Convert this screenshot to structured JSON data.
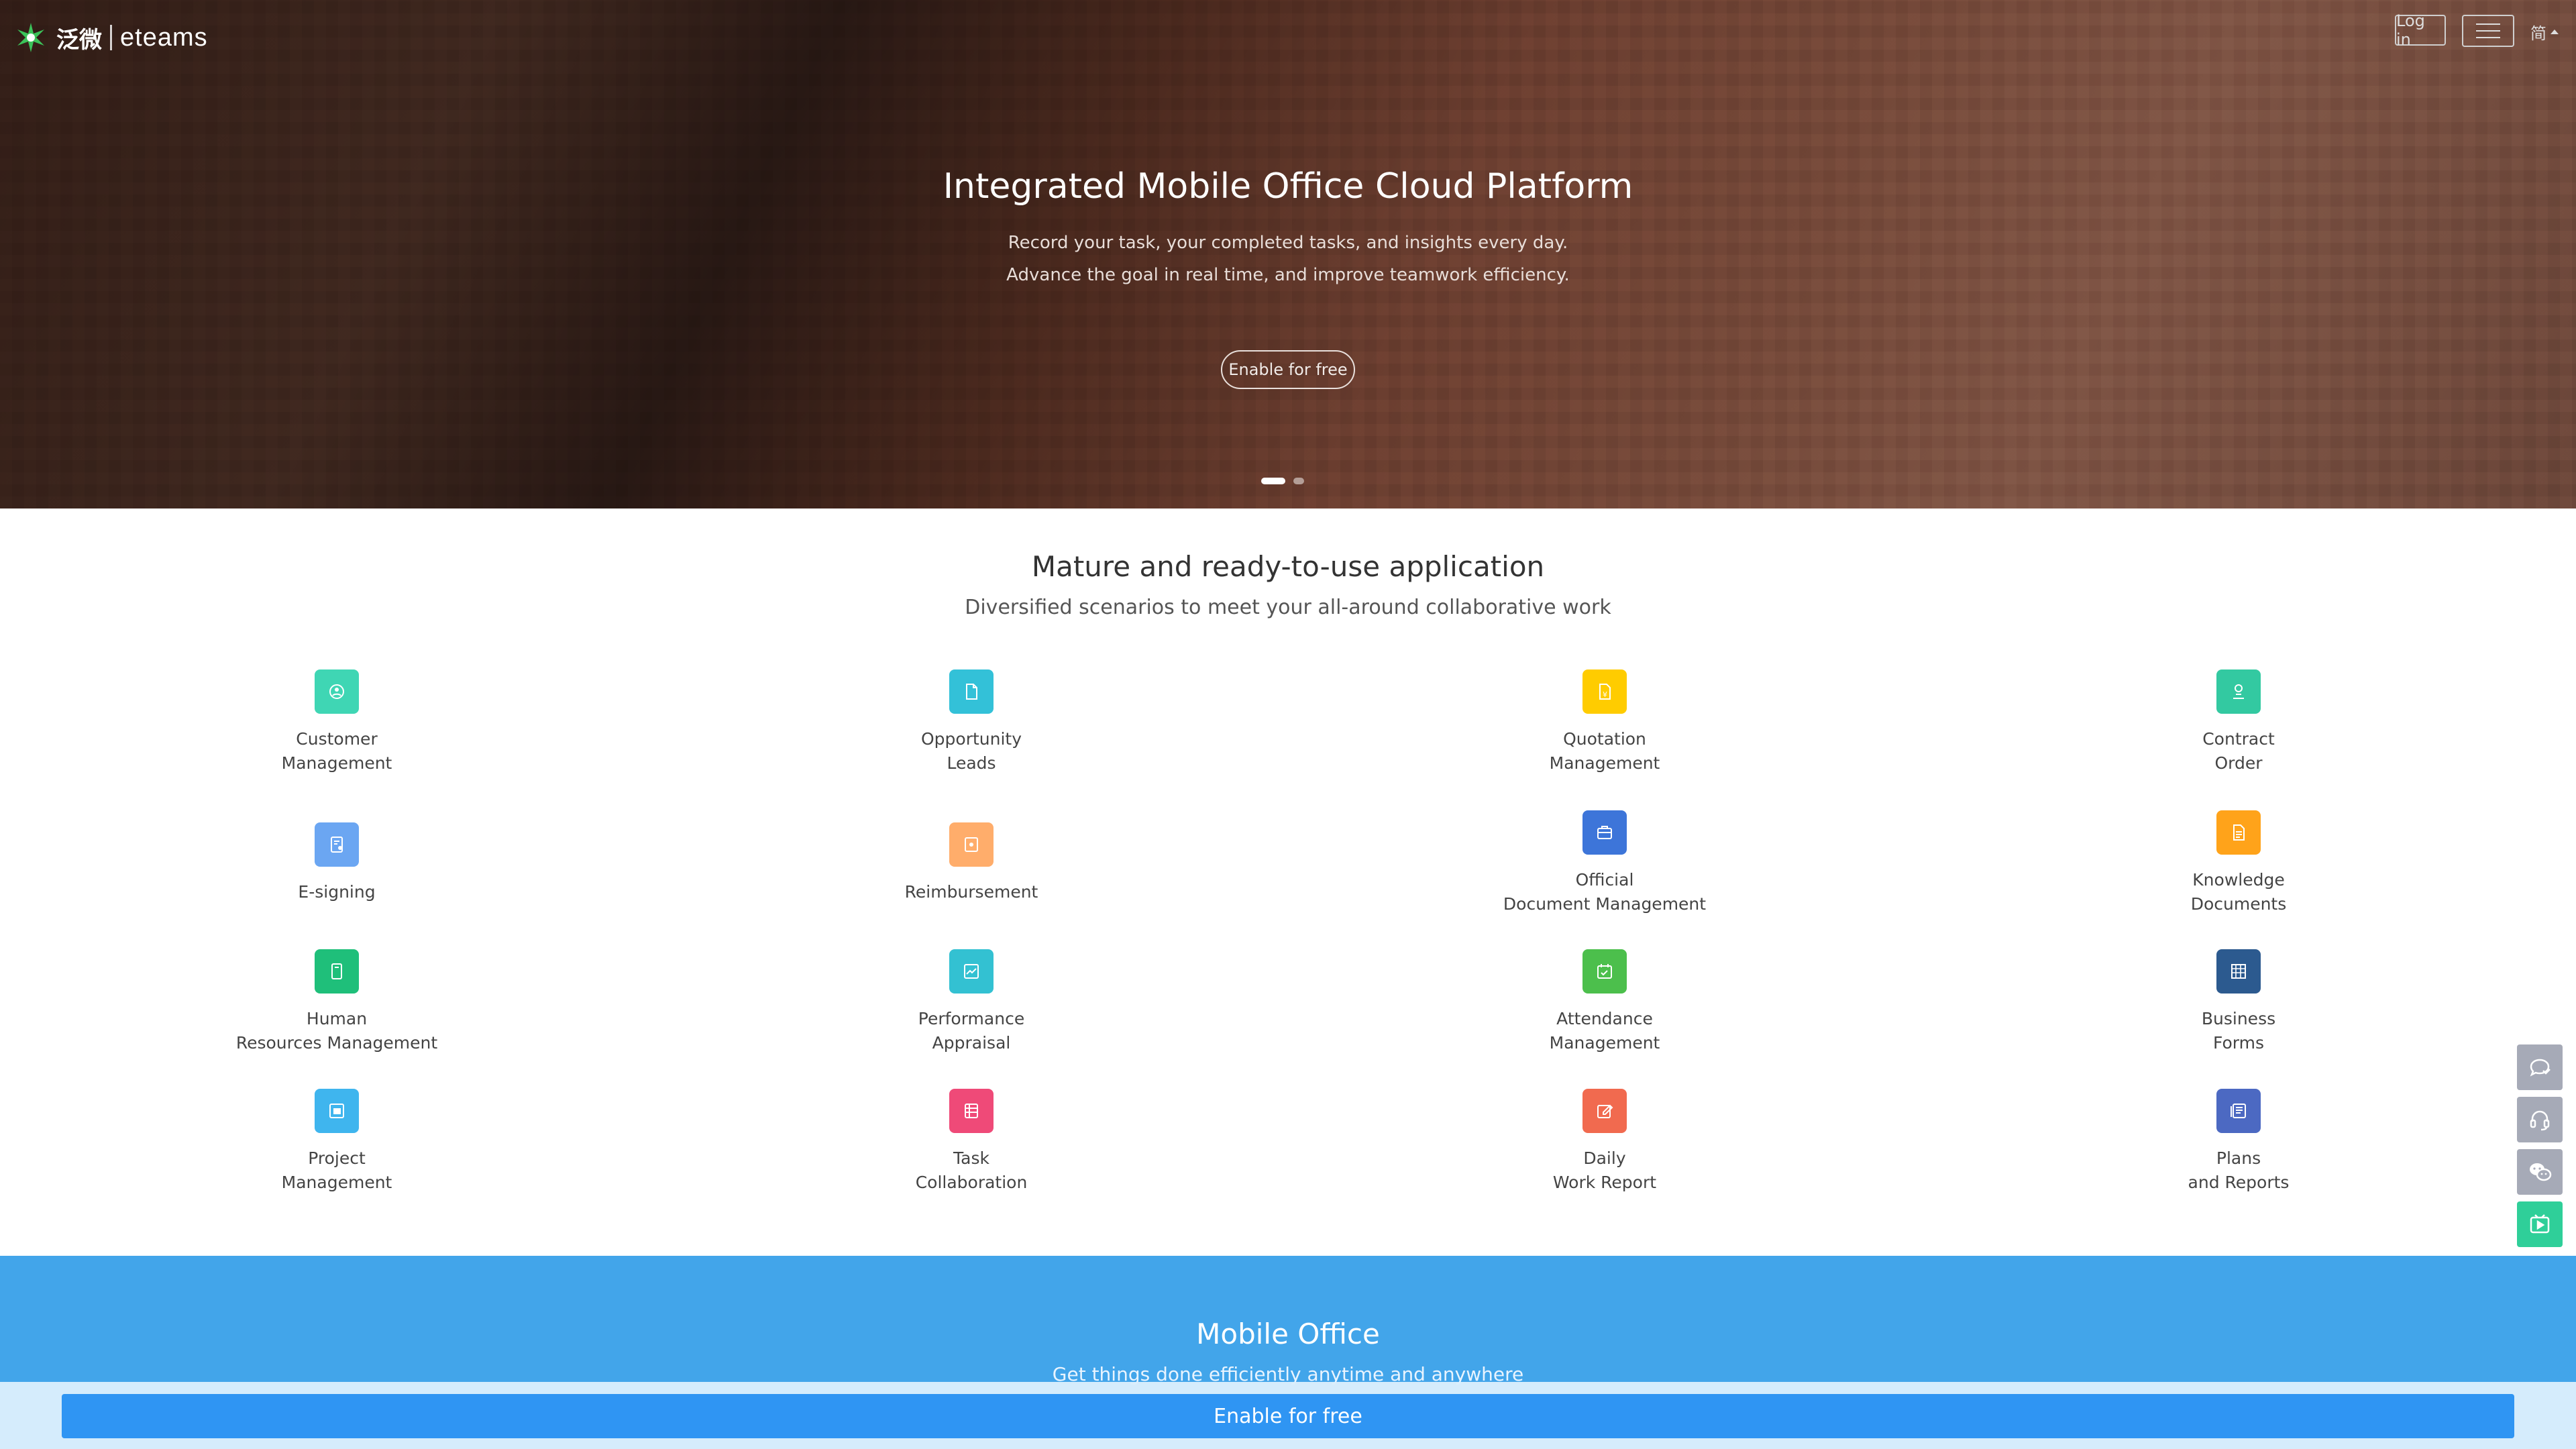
{
  "header": {
    "logo_cn": "泛微",
    "logo_en": "eteams",
    "login_label": "Log in",
    "lang_label": "简"
  },
  "hero": {
    "title": "Integrated Mobile Office Cloud Platform",
    "subtitle_line1": "Record your task, your completed tasks, and insights every day.",
    "subtitle_line2": "Advance the goal in real time, and improve teamwork efficiency.",
    "cta_label": "Enable for free",
    "carousel": {
      "slides": 2,
      "active": 1
    }
  },
  "apps": {
    "title": "Mature and ready-to-use application",
    "subtitle": "Diversified scenarios to meet your all-around collaborative work",
    "items": [
      {
        "label": "Customer\nManagement",
        "icon": "customer-icon",
        "color": "#3fd6b4"
      },
      {
        "label": "Opportunity\nLeads",
        "icon": "document-icon",
        "color": "#33c1d8"
      },
      {
        "label": "Quotation\nManagement",
        "icon": "quotation-icon",
        "color": "#ffcc00"
      },
      {
        "label": "Contract\nOrder",
        "icon": "contract-icon",
        "color": "#33c9a1"
      },
      {
        "label": "E-signing",
        "icon": "esign-icon",
        "color": "#6ba6f2"
      },
      {
        "label": "Reimbursement",
        "icon": "reimbursement-icon",
        "color": "#ffad6b"
      },
      {
        "label": "Official\nDocument Management",
        "icon": "briefcase-icon",
        "color": "#3d75d9"
      },
      {
        "label": "Knowledge\nDocuments",
        "icon": "knowledge-icon",
        "color": "#ffa31a"
      },
      {
        "label": "Human\nResources Management",
        "icon": "hr-icon",
        "color": "#1fbf7a"
      },
      {
        "label": "Performance\nAppraisal",
        "icon": "performance-icon",
        "color": "#33c1d2"
      },
      {
        "label": "Attendance\nManagement",
        "icon": "attendance-icon",
        "color": "#4cbf4c"
      },
      {
        "label": "Business\nForms",
        "icon": "grid-icon",
        "color": "#2c5a8f"
      },
      {
        "label": "Project\nManagement",
        "icon": "project-icon",
        "color": "#3fb5ee"
      },
      {
        "label": "Task\nCollaboration",
        "icon": "task-icon",
        "color": "#ef4a78"
      },
      {
        "label": "Daily\nWork Report",
        "icon": "edit-icon",
        "color": "#f16a4f"
      },
      {
        "label": "Plans\nand Reports",
        "icon": "plans-icon",
        "color": "#4c69c2"
      }
    ]
  },
  "mobile": {
    "title": "Mobile Office",
    "subtitle": "Get things done efficiently anytime and anywhere"
  },
  "bottom": {
    "cta_label": "Enable for free"
  },
  "floating": {
    "colors": {
      "gray": "#a6aab7",
      "green": "#2fcf99"
    }
  }
}
